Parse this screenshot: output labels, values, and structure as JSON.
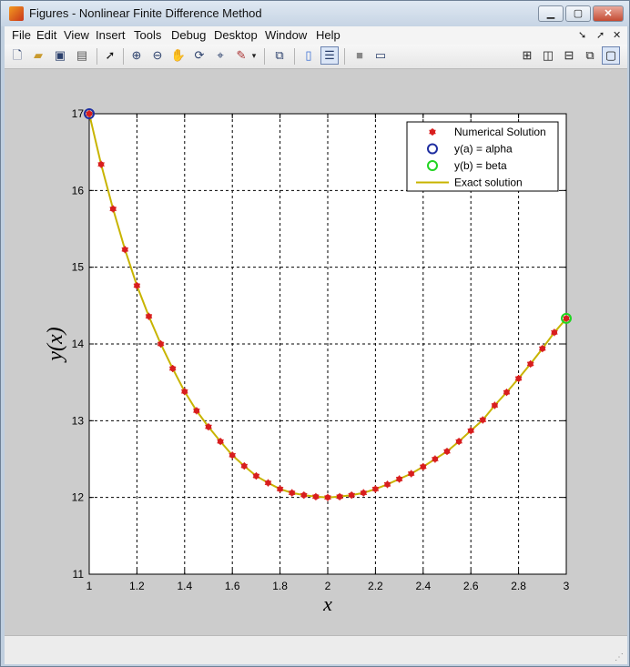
{
  "window": {
    "title": "Figures - Nonlinear Finite Difference Method"
  },
  "menu": [
    "File",
    "Edit",
    "View",
    "Insert",
    "Tools",
    "Debug",
    "Desktop",
    "Window",
    "Help"
  ],
  "toolbar_icons": [
    "new-figure-icon",
    "open-file-icon",
    "save-icon",
    "print-icon",
    "pointer-icon",
    "zoom-in-icon",
    "zoom-out-icon",
    "pan-icon",
    "rotate-icon",
    "data-cursor-icon",
    "brush-icon",
    "brush-dropdown-icon",
    "link-plot-icon",
    "colorbar-icon",
    "legend-icon",
    "hide-plot-tools-icon",
    "show-plot-tools-icon",
    "tile-icon",
    "left-right-icon",
    "top-bottom-icon",
    "float-icon",
    "maximize-icon"
  ],
  "colors": {
    "numerical": "#d81e1e",
    "alpha": "#1f2ea0",
    "beta": "#22d422",
    "exact": "#c8b400"
  },
  "chart_data": {
    "type": "line",
    "xlabel": "x",
    "ylabel": "y(x)",
    "xlim": [
      1,
      3
    ],
    "ylim": [
      11,
      17
    ],
    "xticks": [
      "1",
      "1.2",
      "1.4",
      "1.6",
      "1.8",
      "2",
      "2.2",
      "2.4",
      "2.6",
      "2.8",
      "3"
    ],
    "yticks": [
      "11",
      "12",
      "13",
      "14",
      "15",
      "16",
      "17"
    ],
    "grid": true,
    "legend_position": "top-right",
    "legend": [
      "Numerical Solution",
      "y(a) = alpha",
      "y(b) = beta",
      "Exact solution"
    ],
    "series": [
      {
        "name": "Numerical Solution",
        "marker": "asterisk",
        "x": [
          1.05,
          1.1,
          1.15,
          1.2,
          1.25,
          1.3,
          1.35,
          1.4,
          1.45,
          1.5,
          1.55,
          1.6,
          1.65,
          1.7,
          1.75,
          1.8,
          1.85,
          1.9,
          1.95,
          2.0,
          2.05,
          2.1,
          2.15,
          2.2,
          2.25,
          2.3,
          2.35,
          2.4,
          2.45,
          2.5,
          2.55,
          2.6,
          2.65,
          2.7,
          2.75,
          2.8,
          2.85,
          2.9,
          2.95
        ],
        "y": [
          16.34,
          15.76,
          15.23,
          14.76,
          14.36,
          14.0,
          13.68,
          13.38,
          13.13,
          12.92,
          12.73,
          12.55,
          12.41,
          12.28,
          12.19,
          12.11,
          12.06,
          12.03,
          12.01,
          12.0,
          12.01,
          12.03,
          12.06,
          12.11,
          12.17,
          12.24,
          12.31,
          12.4,
          12.5,
          12.6,
          12.73,
          12.87,
          13.01,
          13.2,
          13.37,
          13.55,
          13.74,
          13.94,
          14.15
        ]
      },
      {
        "name": "y(a) = alpha",
        "marker": "circle",
        "x": [
          1
        ],
        "y": [
          17
        ]
      },
      {
        "name": "y(b) = beta",
        "marker": "circle",
        "x": [
          3
        ],
        "y": [
          14.3333
        ]
      },
      {
        "name": "Exact solution",
        "marker": "line",
        "x": [
          1.0,
          1.05,
          1.1,
          1.15,
          1.2,
          1.25,
          1.3,
          1.35,
          1.4,
          1.45,
          1.5,
          1.55,
          1.6,
          1.65,
          1.7,
          1.75,
          1.8,
          1.85,
          1.9,
          1.95,
          2.0,
          2.05,
          2.1,
          2.15,
          2.2,
          2.25,
          2.3,
          2.35,
          2.4,
          2.45,
          2.5,
          2.55,
          2.6,
          2.65,
          2.7,
          2.75,
          2.8,
          2.85,
          2.9,
          2.95,
          3.0
        ],
        "y": [
          17.0,
          16.34,
          15.76,
          15.23,
          14.76,
          14.36,
          14.0,
          13.68,
          13.38,
          13.13,
          12.92,
          12.73,
          12.55,
          12.41,
          12.28,
          12.19,
          12.11,
          12.06,
          12.03,
          12.01,
          12.0,
          12.01,
          12.03,
          12.06,
          12.11,
          12.17,
          12.24,
          12.31,
          12.4,
          12.5,
          12.6,
          12.73,
          12.87,
          13.01,
          13.2,
          13.37,
          13.55,
          13.74,
          13.94,
          14.15,
          14.33
        ]
      }
    ]
  }
}
